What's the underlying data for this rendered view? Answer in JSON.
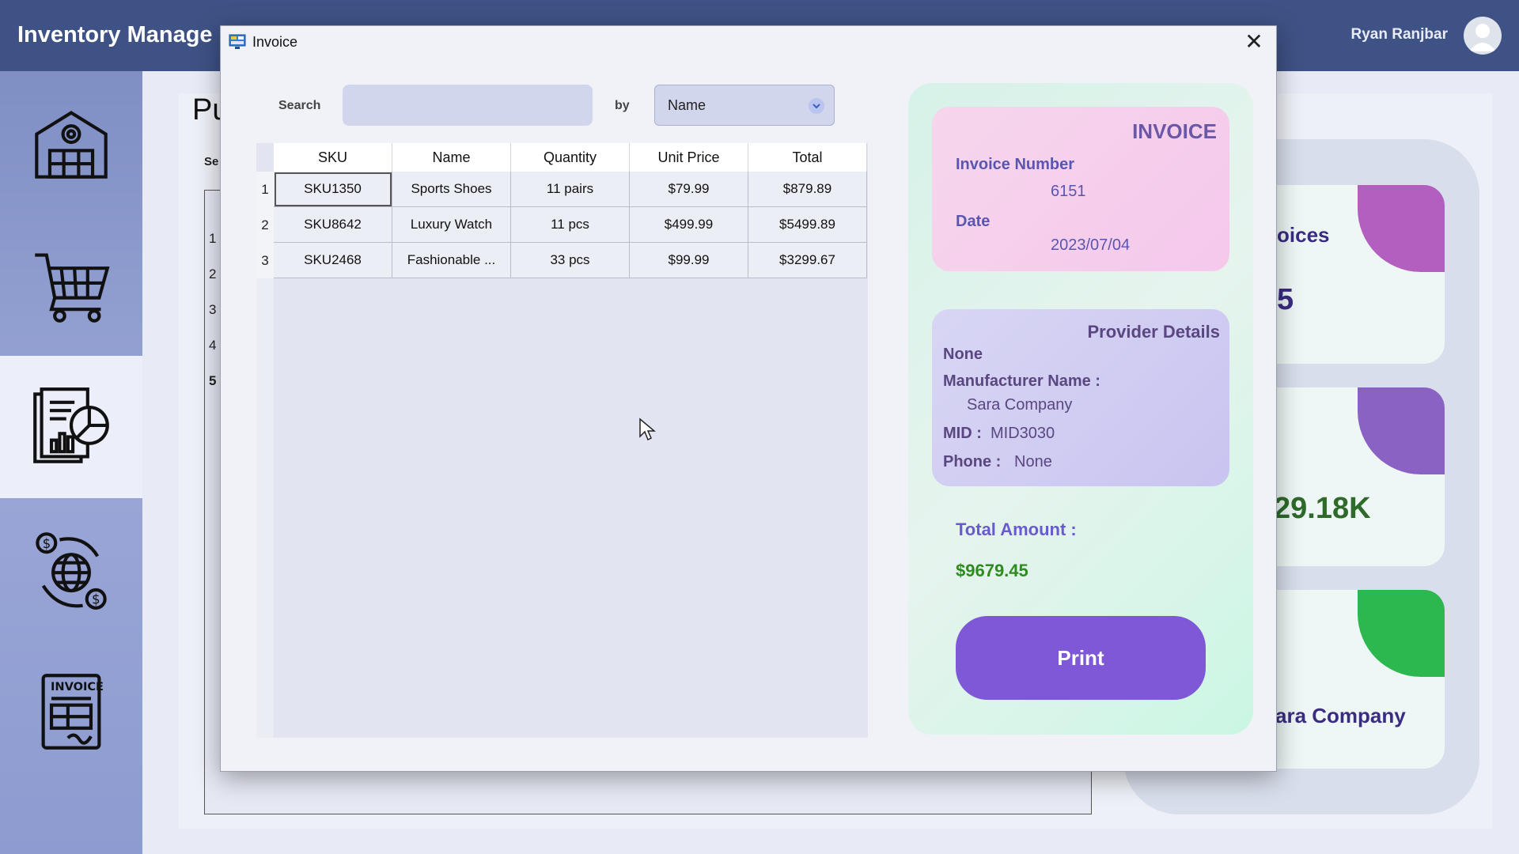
{
  "app": {
    "title": "Inventory Manage",
    "user_name": "Ryan Ranjbar"
  },
  "sidebar": {
    "items": [
      {
        "icon": "warehouse-icon",
        "active": false
      },
      {
        "icon": "shopping-cart-icon",
        "active": false
      },
      {
        "icon": "report-icon",
        "active": true
      },
      {
        "icon": "global-currency-icon",
        "active": false
      },
      {
        "icon": "invoice-icon",
        "active": false
      }
    ]
  },
  "background": {
    "heading": "Pu",
    "search_label": "Se",
    "row_numbers": [
      "1",
      "2",
      "3",
      "4",
      "5"
    ],
    "cards": [
      {
        "text_a": "oices",
        "text_b": "5",
        "blob_color": "#b25fc0"
      },
      {
        "text_a": ":",
        "text_b": "29.18K",
        "blob_color": "#8a62c4"
      },
      {
        "text_a": "",
        "text_b": "ara Company",
        "blob_color": "#2cb84e"
      }
    ]
  },
  "modal": {
    "title": "Invoice",
    "close_glyph": "✕",
    "search": {
      "label": "Search",
      "value": "",
      "placeholder": "",
      "by_label": "by",
      "by_selected": "Name"
    },
    "table": {
      "columns": [
        "SKU",
        "Name",
        "Quantity",
        "Unit Price",
        "Total"
      ],
      "rows": [
        {
          "num": "1",
          "sku": "SKU1350",
          "name": "Sports Shoes",
          "quantity": "11 pairs",
          "unit_price": "$79.99",
          "total": "$879.89"
        },
        {
          "num": "2",
          "sku": "SKU8642",
          "name": "Luxury Watch",
          "quantity": "11 pcs",
          "unit_price": "$499.99",
          "total": "$5499.89"
        },
        {
          "num": "3",
          "sku": "SKU2468",
          "name": "Fashionable ...",
          "quantity": "33 pcs",
          "unit_price": "$99.99",
          "total": "$3299.67"
        }
      ]
    },
    "invoice": {
      "heading": "INVOICE",
      "number_label": "Invoice Number",
      "number_value": "6151",
      "date_label": "Date",
      "date_value": "2023/07/04"
    },
    "provider": {
      "heading": "Provider Details",
      "name": "None",
      "manufacturer_label": "Manufacturer Name :",
      "manufacturer_value": "Sara Company",
      "mid_label": "MID :",
      "mid_value": "MID3030",
      "phone_label": "Phone :",
      "phone_value": "None"
    },
    "total": {
      "label": "Total Amount :",
      "value": "$9679.45"
    },
    "print_label": "Print"
  },
  "colors": {
    "topbar": "#3e5285",
    "print_button": "#7e58d6",
    "total_value": "#2e8b1e"
  }
}
